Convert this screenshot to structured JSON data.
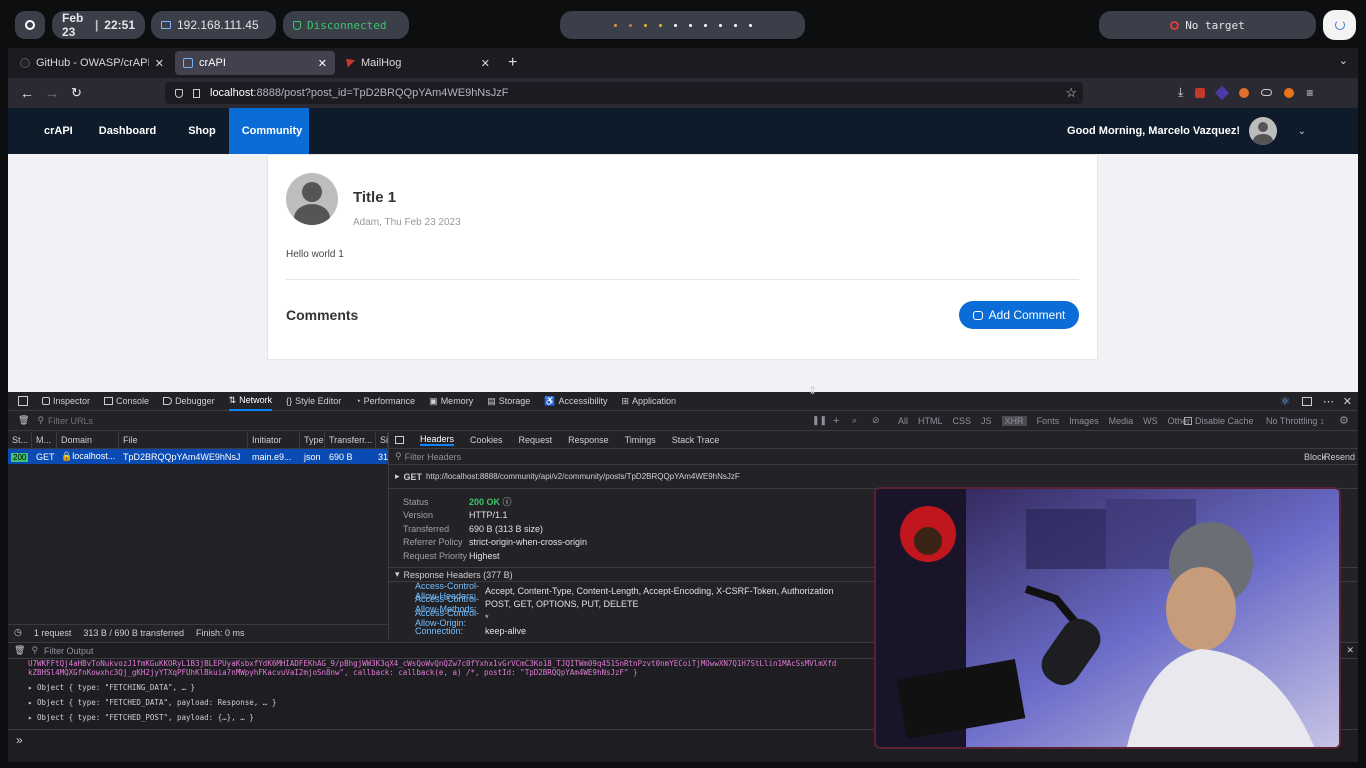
{
  "topbar": {
    "date": "Feb 23",
    "time": "22:51",
    "ip": "192.168.111.45",
    "vpn_status": "Disconnected",
    "target": "No target"
  },
  "browser": {
    "tabs": [
      {
        "label": "GitHub - OWASP/crAPI: co"
      },
      {
        "label": "crAPI"
      },
      {
        "label": "MailHog"
      }
    ],
    "url_host": "localhost",
    "url_rest": ":8888/post?post_id=TpD2BRQQpYAm4WE9hNsJzF"
  },
  "site": {
    "brand": "crAPI",
    "nav": [
      "Dashboard",
      "Shop",
      "Community"
    ],
    "greeting": "Good Morning, Marcelo Vazquez!",
    "post_title": "Title 1",
    "post_meta": "Adam, Thu Feb 23 2023",
    "post_body": "Hello world 1",
    "comments_heading": "Comments",
    "add_comment": "Add Comment"
  },
  "devtools": {
    "tabs": [
      "Inspector",
      "Console",
      "Debugger",
      "Network",
      "Style Editor",
      "Performance",
      "Memory",
      "Storage",
      "Accessibility",
      "Application"
    ],
    "filter_urls": "Filter URLs",
    "type_filters": [
      "All",
      "HTML",
      "CSS",
      "JS",
      "XHR",
      "Fonts",
      "Images",
      "Media",
      "WS",
      "Other"
    ],
    "disable_cache": "Disable Cache",
    "throttling": "No Throttling ↕",
    "columns": [
      "St...",
      "M...",
      "Domain",
      "File",
      "Initiator",
      "Type",
      "Transferr...",
      "Si"
    ],
    "request": {
      "status": "200",
      "method": "GET",
      "domain": "localhost...",
      "file": "TpD2BRQQpYAm4WE9hNsJ",
      "initiator": "main.e9...",
      "type": "json",
      "transferred": "690 B",
      "size": "31"
    },
    "summary": {
      "requests": "1 request",
      "transferred": "313 B / 690 B transferred",
      "finish": "Finish: 0 ms"
    },
    "detail_tabs": [
      "Headers",
      "Cookies",
      "Request",
      "Response",
      "Timings",
      "Stack Trace"
    ],
    "filter_headers": "Filter Headers",
    "block": "Block",
    "resend": "Resend",
    "get_line_method": "GET",
    "get_line_url": "http://localhost:8888/community/api/v2/community/posts/TpD2BRQQpYAm4WE9hNsJzF",
    "status_rows": [
      {
        "k": "Status",
        "v": "200 OK"
      },
      {
        "k": "Version",
        "v": "HTTP/1.1"
      },
      {
        "k": "Transferred",
        "v": "690 B (313 B size)"
      },
      {
        "k": "Referrer Policy",
        "v": "strict-origin-when-cross-origin"
      },
      {
        "k": "Request Priority",
        "v": "Highest"
      }
    ],
    "response_headers_title": "Response Headers (377 B)",
    "response_headers": [
      {
        "k": "Access-Control-Allow-Headers:",
        "v": "Accept, Content-Type, Content-Length, Accept-Encoding, X-CSRF-Token, Authorization"
      },
      {
        "k": "Access-Control-Allow-Methods:",
        "v": "POST, GET, OPTIONS, PUT, DELETE"
      },
      {
        "k": "Access-Control-Allow-Origin:",
        "v": "*"
      },
      {
        "k": "Connection:",
        "v": "keep-alive"
      }
    ],
    "console_filter": "Filter Output",
    "console_lines": [
      "U7WKFFtQj4aHBvToNukvozJ1fmKGuKKORyL1B3jBLEPUyaKsbxfYdK6MHIADFEKhAG_9/pBhgjWW3K3qX4_cWsQoWvQnQZw7c0fYxhx1vGrVCmC3Ko18_TJQITWm09q451SnRtnPzvt0nmYECoiTjMOwwXN7Q1H7StLlin1MAcSsMVlmXfd",
      "kZBHSl4MQXGfnKowxhc3Qj_gKH2jyYTXqPFUhKlBkuia7nMWpyhFKacvuVaI2mjoSn8nw\", callback: callback(e, a) /*, postId: \"TpD2BRQQpYAm4WE9hNsJzF\" }",
      "▸ Object { type: \"FETCHING_DATA\", … }",
      "▸ Object { type: \"FETCHED_DATA\", payload: Response, … }",
      "▸ Object { type: \"FETCHED_POST\", payload: {…}, … }"
    ],
    "prompt": "»"
  },
  "colors": {
    "accent": "#0a6cd6",
    "nav_bg": "#0d1b2a",
    "devtools_bg": "#232327"
  }
}
